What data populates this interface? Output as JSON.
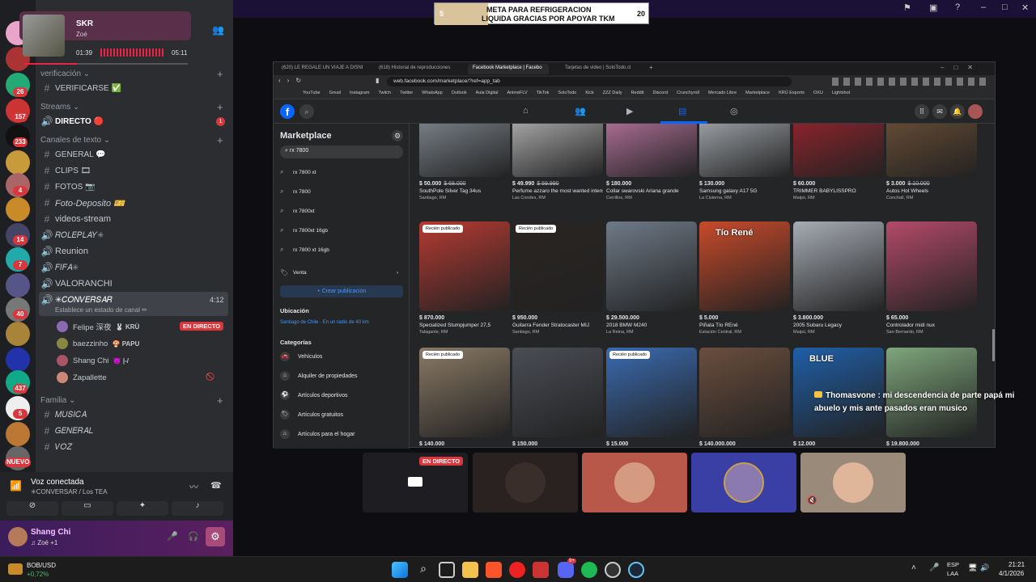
{
  "colors": {
    "accent": "#5865f2",
    "live": "#da373c",
    "fb_blue": "#0866ff"
  },
  "top_banner": {
    "left_number": "5",
    "text_line1": "META PARA REFRIGERACION",
    "text_line2": "LIQUIDA GRACIAS POR APOYAR TKM",
    "right_number": "20"
  },
  "media": {
    "title": "SKR",
    "subtitle": "Zoé",
    "elapsed": "01:39",
    "duration": "05:11",
    "progress": 0.32
  },
  "server_badges": [
    "26",
    "157",
    "233",
    "4",
    "14",
    "7",
    "40",
    "437",
    "5",
    "NUEVO"
  ],
  "channels": {
    "verificacion_cat": "verificación",
    "verificarse": "VERIFICARSE ✅",
    "streams_cat": "Streams",
    "directo": "DIRECTO 🔴",
    "directo_badge": "1",
    "texto_cat": "Canales de texto",
    "general": "GENERAL 💬",
    "clips": "CLIPS 🎞",
    "fotos": "FOTOS 📷",
    "foto_deposito": "Foto-Deposito 🎫",
    "videos_stream": "videos-stream",
    "roleplay": "𝑅𝑂𝐿𝐸𝑃𝐿𝐴𝑌✳",
    "reunion": "Reunion",
    "fifa": "𝐹𝐼𝐹𝐴✳",
    "valoranchi": "VALORANCHI",
    "conversar": "✳𝐶𝑂𝑁𝑉𝐸𝑅𝑆𝐴𝑅",
    "conversar_time": "4:12",
    "conversar_status": "Establece un estado de canal ✏",
    "familia_cat": "Familia",
    "musica": "𝑀𝑈𝑆𝐼𝐶𝐴",
    "general2": "𝐺𝐸𝑁𝐸𝑅𝐴𝐿",
    "voz": "𝑉𝑂𝑍"
  },
  "voice_users": [
    {
      "name": "Felipe 深夜",
      "tag": "🐰 KRÜ",
      "live": "EN DIRECTO"
    },
    {
      "name": "baezzinho",
      "tag": "🍄 PAPU"
    },
    {
      "name": "Shang Chi",
      "tag": "😈 |-/"
    },
    {
      "name": "Zapallette",
      "tag": ""
    }
  ],
  "voice": {
    "status": "Voz conectada",
    "channel": "✳CONVERSAR / Los TEA"
  },
  "user": {
    "name": "Shang Chi",
    "status": "♫ Zoé +1"
  },
  "browser": {
    "tabs": [
      "(620) LE REGALE UN VIAJE A DISNE",
      "(618) Historial de reproducciones",
      "Facebook Marketplace | Facebo",
      "Tarjetas de video | SoloTodo.cl"
    ],
    "url": "web.facebook.com/marketplace/?ref=app_tab",
    "bookmarks": [
      "YouTube",
      "Gmail",
      "Instagram",
      "Twitch",
      "Twitter",
      "WhatsApp",
      "Outlook",
      "Aula Digital",
      "AnimeFLV",
      "TikTok",
      "SoloTodo",
      "Kick",
      "ZZZ Daily",
      "Reddit",
      "Discord",
      "Crunchyroll",
      "Mercado Libre",
      "Marketplace",
      "KRÜ Esports",
      "OXU",
      "Lightshot"
    ]
  },
  "marketplace": {
    "title": "Marketplace",
    "search_value": "rx 7800",
    "suggestions": [
      "rx 7800 xt",
      "rx 7800",
      "rx 7800xt",
      "rx 7800xt 16gb",
      "rx 7800 xt 16gb"
    ],
    "venta": "Venta",
    "create_label": "+ Crear publicación",
    "location_heading": "Ubicación",
    "location_value": "Santiago de Chile · En un radio de 40 km",
    "categories_heading": "Categorías",
    "categories": [
      "Vehículos",
      "Alquiler de propiedades",
      "Artículos deportivos",
      "Artículos gratuitos",
      "Artículos para el hogar"
    ],
    "new_tag": "Recién publicado",
    "items_row1": [
      {
        "price": "$ 50.000",
        "old": "$ 68.000",
        "title": "SouthPole Silver Tag 34us",
        "loc": "Santiago, RM",
        "color": "#9aa3ad"
      },
      {
        "price": "$ 49.990",
        "old": "$ 59.990",
        "title": "Perfume azzaro the most wanted intense",
        "loc": "Las Condes, RM",
        "color": "#d8d8d8"
      },
      {
        "price": "$ 180.000",
        "old": "",
        "title": "Collar swarovski Ariana grande",
        "loc": "Cerrillos, RM",
        "color": "#e08ac0"
      },
      {
        "price": "$ 130.000",
        "old": "",
        "title": "Samsung galaxy A17 5G",
        "loc": "La Cisterna, RM",
        "color": "#c9cfd6"
      },
      {
        "price": "$ 60.000",
        "old": "",
        "title": "TRIMMER BABYLISSPRO",
        "loc": "Maipú, RM",
        "color": "#b52430"
      },
      {
        "price": "$ 3.000",
        "old": "$ 10.000",
        "title": "Autos Hot Wheels",
        "loc": "Conchalí, RM",
        "color": "#7d5b3a"
      }
    ],
    "items_row2": [
      {
        "price": "$ 870.000",
        "title": "Specialized Stumpjumper 27,5",
        "loc": "Talagante, RM",
        "color": "#b63a32",
        "new": true
      },
      {
        "price": "$ 950.000",
        "title": "Guitarra Fender Stratocaster MIJ",
        "loc": "Santiago, RM",
        "color": "#2a2522",
        "new": true
      },
      {
        "price": "$ 29.500.000",
        "title": "2018 BMW M240",
        "loc": "La Reina, RM",
        "color": "#6f7a87",
        "new": false
      },
      {
        "price": "$ 5.000",
        "title": "Piñata Tío REné",
        "loc": "Estación Central, RM",
        "color": "#c94a2a",
        "new": false,
        "overlay": "Tío René"
      },
      {
        "price": "$ 3.800.000",
        "title": "2005 Subaru Legacy",
        "loc": "Maipú, RM",
        "color": "#a7acb4",
        "new": false
      },
      {
        "price": "$ 65.000",
        "title": "Controlador midi nux",
        "loc": "San Bernardo, RM",
        "color": "#b34a6a",
        "new": false
      }
    ],
    "items_row3": [
      {
        "price": "$ 140.000",
        "color": "#8a7a66",
        "new": true
      },
      {
        "price": "$ 150.000",
        "color": "#4a4d55",
        "new": false
      },
      {
        "price": "$ 15.000",
        "color": "#3a6bb0",
        "new": true
      },
      {
        "price": "$ 140.000.000",
        "color": "#6a4e3e",
        "new": false
      },
      {
        "price": "$ 12.000",
        "color": "#1f5fa8",
        "new": false,
        "overlay": "BLUE"
      },
      {
        "price": "$ 19.800.000",
        "color": "#7fa67c",
        "new": false
      }
    ]
  },
  "chat_message": "Thomasvone : mi descendencia de parte papá mi abuelo y mis ante pasados eran musico",
  "stream_live": "EN DIRECTO",
  "crypto": {
    "pair": "BOB/USD",
    "change": "+0,72%"
  },
  "tray": {
    "lang": "ESP",
    "layout": "LAA",
    "time": "21:21",
    "date": "4/1/2026"
  },
  "taskbar_badge": "9+"
}
